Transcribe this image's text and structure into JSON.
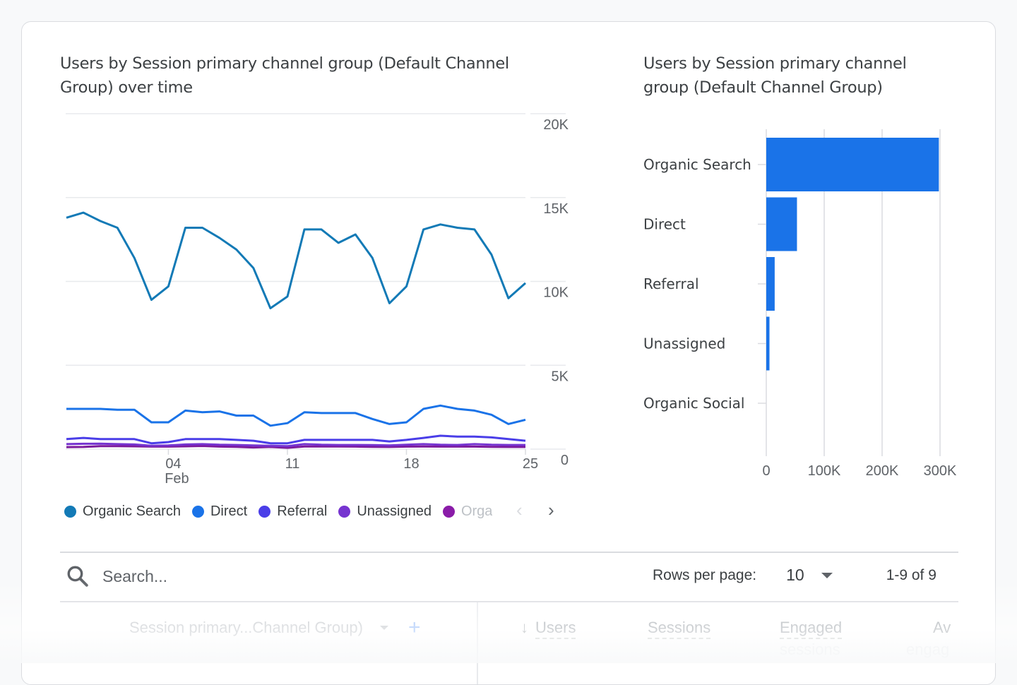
{
  "line_chart": {
    "title": "Users by Session primary channel group (Default Channel Group) over time",
    "legend": [
      {
        "label": "Organic Search",
        "color": "#137ab6"
      },
      {
        "label": "Direct",
        "color": "#1a73e8"
      },
      {
        "label": "Referral",
        "color": "#4a3ee8"
      },
      {
        "label": "Unassigned",
        "color": "#7634d0"
      },
      {
        "label": "Organic Social",
        "color": "#8a1ca8",
        "truncated_label": "Orga"
      }
    ],
    "legend_prev_icon": "chevron-left",
    "legend_next_icon": "chevron-right"
  },
  "bar_chart": {
    "title": "Users by Session primary channel group (Default Channel Group)"
  },
  "chart_data": [
    {
      "type": "line",
      "title": "Users by Session primary channel group (Default Channel Group) over time",
      "x": [
        "Jan 29",
        "Jan 30",
        "Jan 31",
        "Feb 01",
        "Feb 02",
        "Feb 03",
        "Feb 04",
        "Feb 05",
        "Feb 06",
        "Feb 07",
        "Feb 08",
        "Feb 09",
        "Feb 10",
        "Feb 11",
        "Feb 12",
        "Feb 13",
        "Feb 14",
        "Feb 15",
        "Feb 16",
        "Feb 17",
        "Feb 18",
        "Feb 19",
        "Feb 20",
        "Feb 21",
        "Feb 22",
        "Feb 23",
        "Feb 24",
        "Feb 25"
      ],
      "x_tick_labels": [
        {
          "index": 6,
          "label": "04",
          "sublabel": "Feb"
        },
        {
          "index": 13,
          "label": "11"
        },
        {
          "index": 20,
          "label": "18"
        },
        {
          "index": 27,
          "label": "25"
        }
      ],
      "y_tick_labels": [
        "0",
        "5K",
        "10K",
        "15K",
        "20K"
      ],
      "y_ticks": [
        0,
        5000,
        10000,
        15000,
        20000
      ],
      "ylim": [
        0,
        20000
      ],
      "y_axis_side": "right",
      "grid": true,
      "legend_position": "bottom",
      "series": [
        {
          "name": "Organic Search",
          "color": "#137ab6",
          "values": [
            13800,
            14100,
            13600,
            13200,
            11400,
            8900,
            9700,
            13200,
            13200,
            12600,
            11900,
            10800,
            8400,
            9100,
            13100,
            13100,
            12300,
            12800,
            11400,
            8700,
            9700,
            13100,
            13400,
            13200,
            13100,
            11600,
            9000,
            9900
          ]
        },
        {
          "name": "Direct",
          "color": "#1a73e8",
          "values": [
            2400,
            2400,
            2400,
            2350,
            2350,
            1600,
            1600,
            2300,
            2200,
            2250,
            2000,
            2000,
            1400,
            1550,
            2200,
            2150,
            2150,
            2150,
            1800,
            1500,
            1600,
            2400,
            2600,
            2400,
            2300,
            2050,
            1500,
            1750
          ]
        },
        {
          "name": "Referral",
          "color": "#4a3ee8",
          "values": [
            600,
            670,
            600,
            600,
            600,
            350,
            420,
            600,
            600,
            600,
            550,
            500,
            350,
            350,
            550,
            550,
            550,
            550,
            550,
            460,
            550,
            670,
            800,
            750,
            750,
            700,
            600,
            500
          ]
        },
        {
          "name": "Unassigned",
          "color": "#7634d0",
          "values": [
            300,
            320,
            330,
            300,
            280,
            200,
            220,
            280,
            300,
            260,
            250,
            220,
            200,
            180,
            300,
            260,
            250,
            250,
            240,
            220,
            260,
            300,
            260,
            250,
            300,
            260,
            250,
            250
          ]
        },
        {
          "name": "Organic Social",
          "color": "#7b1a9c",
          "values": [
            120,
            130,
            180,
            180,
            170,
            150,
            150,
            170,
            190,
            150,
            140,
            100,
            130,
            80,
            160,
            160,
            160,
            150,
            140,
            130,
            150,
            160,
            150,
            150,
            150,
            140,
            130,
            130
          ]
        }
      ]
    },
    {
      "type": "bar",
      "orientation": "horizontal",
      "title": "Users by Session primary channel group (Default Channel Group)",
      "categories": [
        "Organic Search",
        "Direct",
        "Referral",
        "Unassigned",
        "Organic Social"
      ],
      "values": [
        298000,
        53000,
        14500,
        5500,
        300
      ],
      "bar_color": "#1a73e8",
      "x_tick_labels": [
        "0",
        "100K",
        "200K",
        "300K"
      ],
      "x_ticks": [
        0,
        100000,
        200000,
        300000
      ],
      "xlim": [
        0,
        300000
      ],
      "grid": true
    }
  ],
  "table": {
    "search_placeholder": "Search...",
    "rows_per_page_label": "Rows per page:",
    "rows_per_page_value": "10",
    "range_label": "1-9 of 9",
    "dimension_header": "Session primary...Channel Group)",
    "add_dimension_icon": "+",
    "sort_icon": "↓",
    "columns": [
      "Users",
      "Sessions",
      "Engaged",
      "Av"
    ],
    "column_sublabels": [
      "",
      "",
      "sessions",
      "engag"
    ]
  }
}
